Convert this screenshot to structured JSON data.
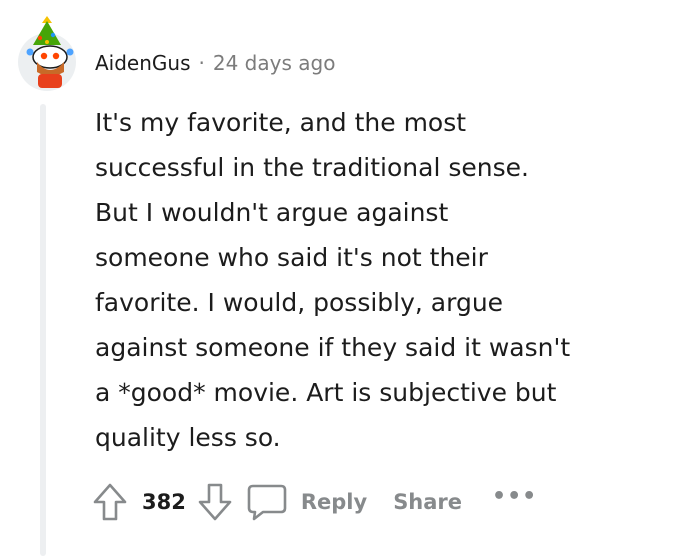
{
  "comment": {
    "username": "AidenGus",
    "separator": "·",
    "timestamp": "24 days ago",
    "body_lines": [
      "It's my favorite, and the most",
      "successful in the traditional sense.",
      "But I wouldn't argue against",
      "someone who said it's not their",
      "favorite. I would, possibly, argue",
      "against someone if they said it wasn't",
      "a *good* movie. Art is subjective but",
      "quality less so."
    ],
    "actions": {
      "vote_count": "382",
      "reply_label": "Reply",
      "share_label": "Share",
      "more_label": "•••"
    },
    "avatar_icon": "snoo-christmas-tree-avatar-icon",
    "icons": {
      "upvote": "upvote-arrow-icon",
      "downvote": "downvote-arrow-icon",
      "reply": "speech-bubble-icon",
      "more": "more-options-icon"
    },
    "colors": {
      "text": "#1c1c1c",
      "muted": "#7c7c7c",
      "action": "#878a8c",
      "thread_line": "#edeff1"
    }
  }
}
